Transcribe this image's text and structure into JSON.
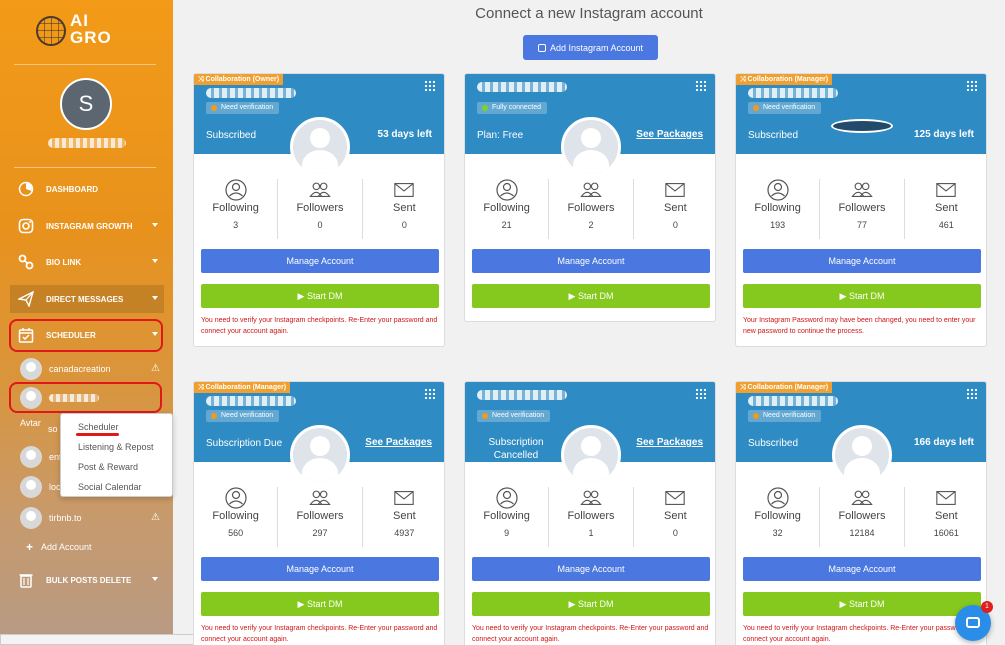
{
  "sidebar": {
    "logo_text": "AI GRO",
    "avatar_letter": "S",
    "nav": [
      {
        "label": "DASHBOARD",
        "icon": "dashboard-icon"
      },
      {
        "label": "INSTAGRAM GROWTH",
        "icon": "instagram-icon"
      },
      {
        "label": "BIO LINK",
        "icon": "link-icon"
      },
      {
        "label": "DIRECT MESSAGES",
        "icon": "paper-plane-icon"
      },
      {
        "label": "SCHEDULER",
        "icon": "calendar-check-icon"
      }
    ],
    "accounts": [
      {
        "name": "canadacreation",
        "warn": true
      },
      {
        "name": "",
        "warn": false
      },
      {
        "name": "so",
        "warn": false
      },
      {
        "name": "ent",
        "warn": false
      },
      {
        "name": "loc",
        "warn": false
      },
      {
        "name": "tirbnb.to",
        "warn": true
      }
    ],
    "avtar_text": "Avtar",
    "add_account": "Add Account",
    "bulk_delete": "BULK POSTS DELETE"
  },
  "dropdown": {
    "items": [
      "Scheduler",
      "Listening & Repost",
      "Post & Reward",
      "Social Calendar"
    ]
  },
  "main": {
    "title": "Connect a new Instagram account",
    "add_button": "Add Instagram Account"
  },
  "stat_labels": {
    "following": "Following",
    "followers": "Followers",
    "sent": "Sent"
  },
  "buttons": {
    "manage": "Manage Account",
    "start_dm": "▶ Start DM"
  },
  "cards": [
    {
      "badge": "⤨ Collaboration (Owner)",
      "verify": "Need verification",
      "status": "Subscribed",
      "right": "53 days left",
      "following": "3",
      "followers": "0",
      "sent": "0",
      "error": "You need to verify your Instagram checkpoints. Re-Enter your password and connect your account again."
    },
    {
      "badge": "",
      "verify": "Fully connected",
      "status": "Plan: Free",
      "right": "See Packages",
      "following": "21",
      "followers": "2",
      "sent": "0",
      "error": ""
    },
    {
      "badge": "⤨ Collaboration (Manager)",
      "verify": "Need verification",
      "status": "Subscribed",
      "right": "125 days left",
      "following": "193",
      "followers": "77",
      "sent": "461",
      "error": "Your Instagram Password may have been changed, you need to enter your new password to continue the process."
    },
    {
      "badge": "⤨ Collaboration (Manager)",
      "verify": "Need verification",
      "status": "Subscription Due",
      "right": "See Packages",
      "following": "560",
      "followers": "297",
      "sent": "4937",
      "error": "You need to verify your Instagram checkpoints. Re-Enter your password and connect your account again."
    },
    {
      "badge": "",
      "verify": "Need verification",
      "status": "Subscription Cancelled",
      "right": "See Packages",
      "following": "9",
      "followers": "1",
      "sent": "0",
      "error": "You need to verify your Instagram checkpoints. Re-Enter your password and connect your account again."
    },
    {
      "badge": "⤨ Collaboration (Manager)",
      "verify": "Need verification",
      "status": "Subscribed",
      "right": "166 days left",
      "following": "32",
      "followers": "12184",
      "sent": "16061",
      "error": "You need to verify your Instagram checkpoints. Re-Enter your password and connect your account again."
    }
  ],
  "chat": {
    "badge": "1"
  },
  "colors": {
    "sidebar_top": "#f39a18",
    "header_blue": "#2e8bc3",
    "manage_blue": "#4a78e0",
    "dm_green": "#86c91e",
    "error_red": "#d01515",
    "highlight_red": "#e01818"
  }
}
